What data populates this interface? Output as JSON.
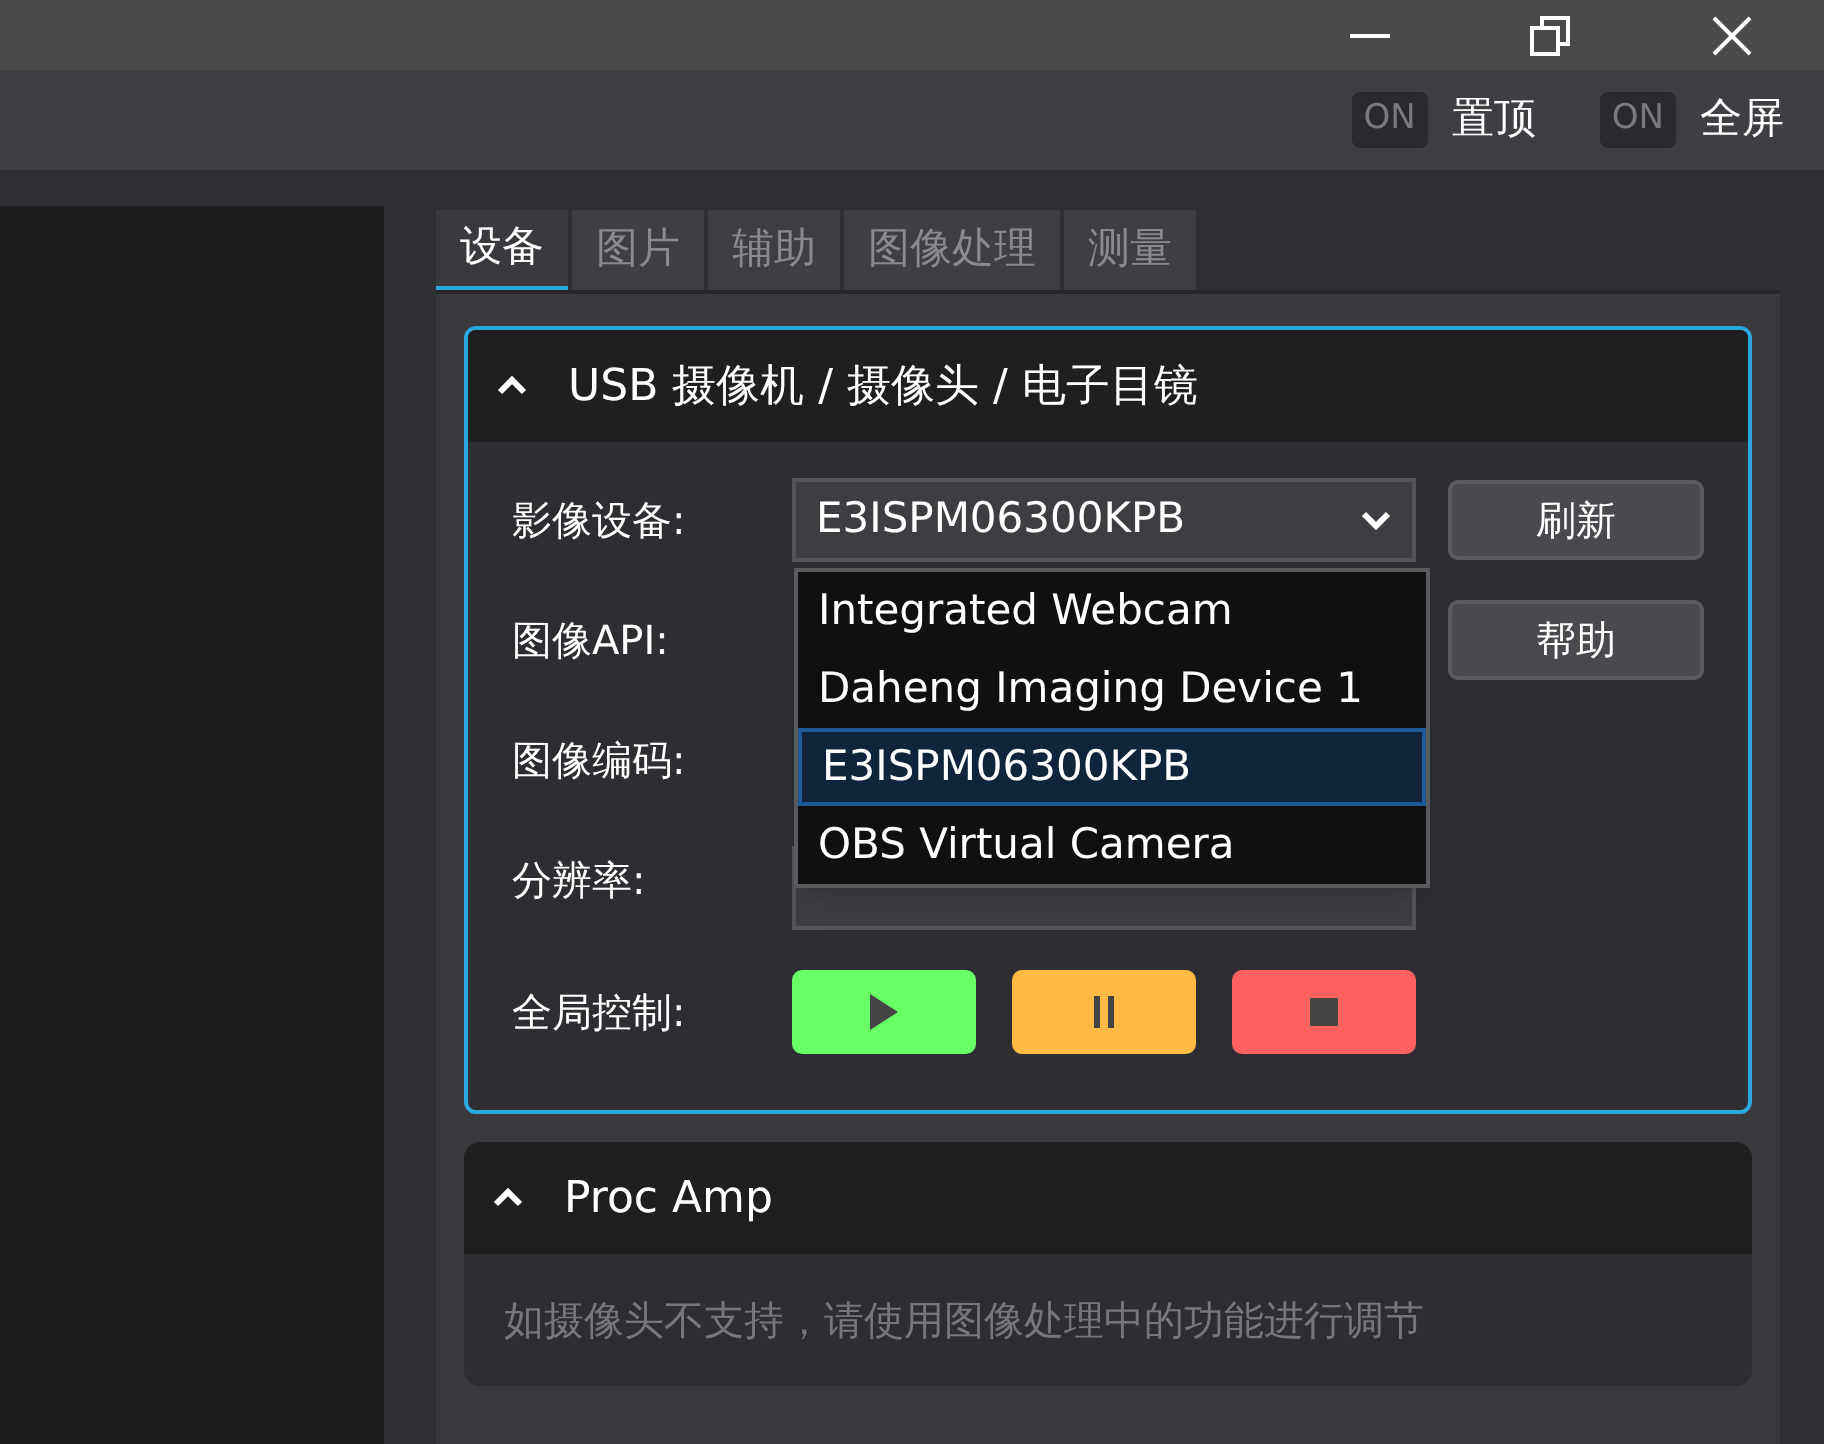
{
  "toolbar": {
    "toggles": [
      {
        "switch_text": "ON",
        "label": "置顶",
        "on": false
      },
      {
        "switch_text": "ON",
        "label": "全屏",
        "on": false
      }
    ]
  },
  "tabs": [
    {
      "label": "设备",
      "selected": true
    },
    {
      "label": "图片",
      "selected": false
    },
    {
      "label": "辅助",
      "selected": false
    },
    {
      "label": "图像处理",
      "selected": false
    },
    {
      "label": "测量",
      "selected": false
    }
  ],
  "device_group": {
    "title": "USB 摄像机 / 摄像头 / 电子目镜",
    "expanded": true,
    "rows": [
      {
        "kind": "combo",
        "label": "影像设备:",
        "value": "E3ISPM06300KPB",
        "button": "刷新"
      },
      {
        "kind": "hidden",
        "label": "图像API:",
        "button": "帮助"
      },
      {
        "kind": "hidden",
        "label": "图像编码:"
      },
      {
        "kind": "empty",
        "label": "分辨率:"
      }
    ],
    "control": {
      "label": "全局控制:",
      "buttons": [
        {
          "kind": "play",
          "color": "#66ff66"
        },
        {
          "kind": "pause",
          "color": "#ffbb44"
        },
        {
          "kind": "stop",
          "color": "#ff6060"
        }
      ]
    },
    "dropdown": {
      "options": [
        {
          "label": "Integrated Webcam",
          "selected": false
        },
        {
          "label": "Daheng Imaging Device 1",
          "selected": false
        },
        {
          "label": "E3ISPM06300KPB",
          "selected": true
        },
        {
          "label": "OBS Virtual Camera",
          "selected": false
        }
      ]
    }
  },
  "proc_amp": {
    "title": "Proc Amp",
    "expanded": true,
    "note": "如摄像头不支持，请使用图像处理中的功能进行调节"
  }
}
